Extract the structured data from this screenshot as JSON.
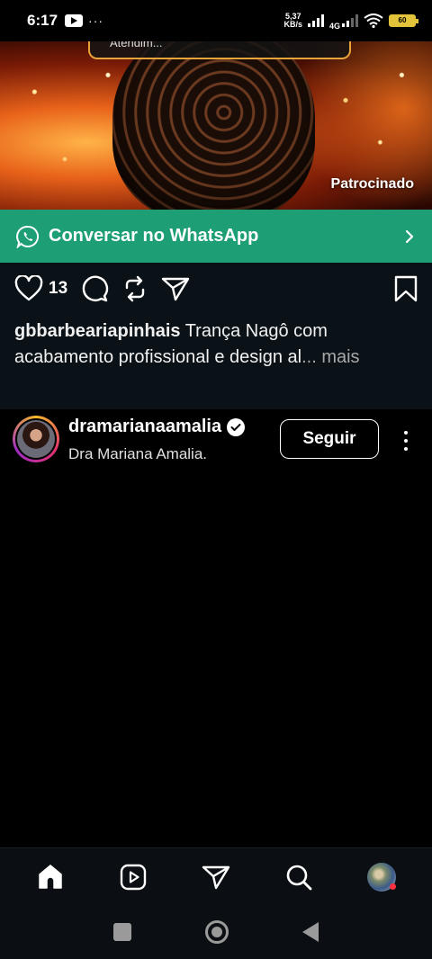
{
  "status_bar": {
    "time": "6:17",
    "dots": "···",
    "net_speed_value": "5,37",
    "net_speed_unit": "KB/s",
    "net_type": "4G",
    "battery": "60"
  },
  "ad": {
    "badge_text": "Atendim...",
    "sponsored_label": "Patrocinado",
    "cta_label": "Conversar no WhatsApp"
  },
  "post": {
    "like_count": "13",
    "caption_user": "gbbarbeariapinhais",
    "caption_text": " Trança Nagô com acabamento profissional e design al",
    "caption_more": "... mais"
  },
  "next_post": {
    "username": "dramarianaamalia",
    "subtitle": "Dra Mariana Amalia.",
    "follow_label": "Seguir"
  },
  "bottom_nav": {
    "items": [
      "home-icon",
      "reels-icon",
      "direct-icon",
      "search-icon",
      "profile-avatar"
    ]
  },
  "colors": {
    "whatsapp_green": "#1d9e74",
    "footer_bg": "#0a1218",
    "notification_red": "#ff3040"
  }
}
